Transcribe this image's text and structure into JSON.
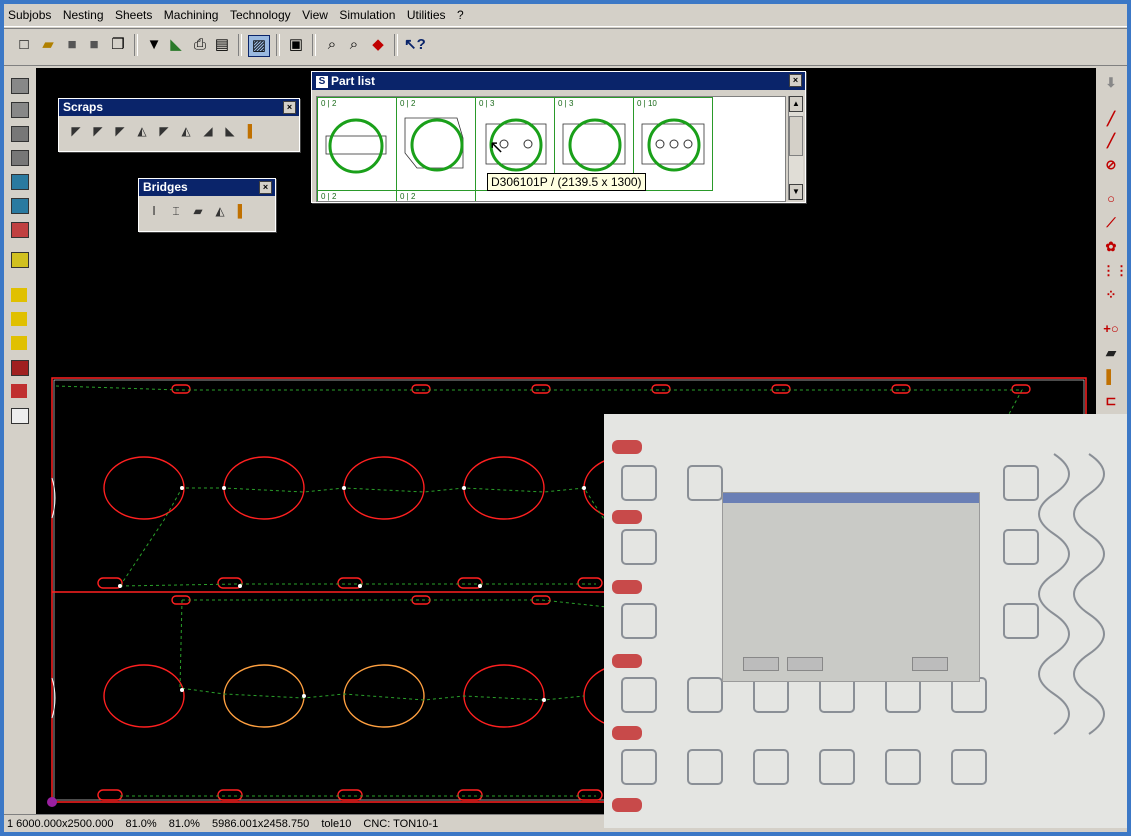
{
  "menu": [
    "Subjobs",
    "Nesting",
    "Sheets",
    "Machining",
    "Technology",
    "View",
    "Simulation",
    "Utilities",
    "?"
  ],
  "toolbar_icons": [
    "new-icon",
    "open-icon",
    "save-icon",
    "save-as-icon",
    "copy-icon",
    "dropdown-icon",
    "import-icon",
    "print-icon",
    "print-preview-icon",
    "sheet-view-icon",
    "window-icon",
    "zoom-icon",
    "zoom-area-icon",
    "color-icon",
    "help-cursor-icon"
  ],
  "left_tools": [
    "tool-1",
    "tool-2",
    "tool-3",
    "tool-4",
    "tool-5",
    "tool-6",
    "tool-7",
    "tool-8",
    "tool-9",
    "tool-10",
    "tool-11",
    "tool-12",
    "tool-13",
    "tool-14"
  ],
  "right_tools": [
    "arrow-down-icon",
    "line-icon",
    "line-icon",
    "contour-icon",
    "circle-icon",
    "slot-icon",
    "circle-grid-icon",
    "grid-icon",
    "pattern-icon",
    "circle-add-icon",
    "punch-icon",
    "toolset-icon",
    "bridge-tool-icon"
  ],
  "scraps": {
    "title": "Scraps",
    "close": "×"
  },
  "bridges": {
    "title": "Bridges",
    "close": "×"
  },
  "part_list": {
    "title": "Part list",
    "close": "×",
    "parts": [
      {
        "qty": "0 | 2"
      },
      {
        "qty": "0 | 2"
      },
      {
        "qty": "0 | 3"
      },
      {
        "qty": "0 | 3"
      },
      {
        "qty": "0 | 10"
      }
    ],
    "row2": [
      "0 | 2",
      "0 | 2"
    ],
    "tooltip": "D306101P / (2139.5 x 1300)"
  },
  "status": {
    "sheet": "1 6000.000x2500.000",
    "zoom1": "81.0%",
    "zoom2": "81.0%",
    "dims": "5986.001x2458.750",
    "material": "tole10",
    "cnc": "CNC: TON10-1"
  },
  "colors": {
    "accent": "#3c78c6",
    "titlebar": "#0a246a",
    "part": "#ff2020",
    "path": "#2aa02a"
  }
}
